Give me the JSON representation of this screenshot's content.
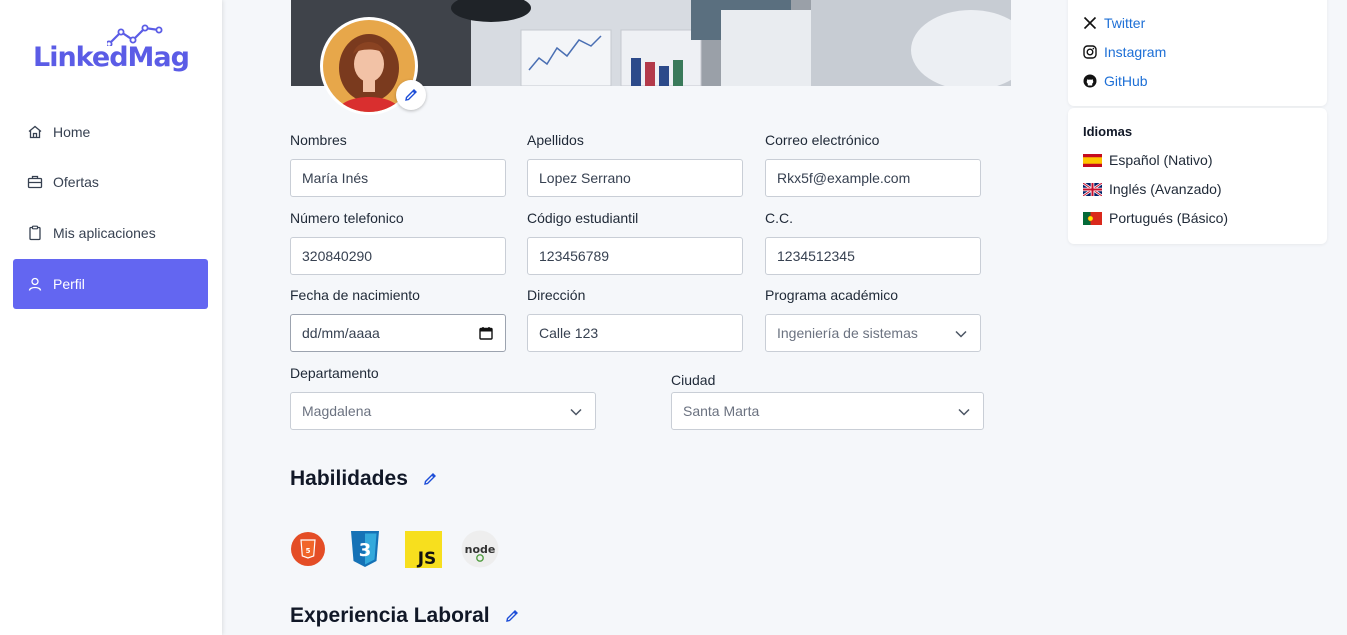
{
  "brand": {
    "name": "LinkedMag",
    "color": "#5b5ce6"
  },
  "nav": {
    "items": [
      {
        "label": "Home",
        "icon": "home-icon"
      },
      {
        "label": "Ofertas",
        "icon": "briefcase-icon"
      },
      {
        "label": "Mis aplicaciones",
        "icon": "clipboard-icon"
      },
      {
        "label": "Perfil",
        "icon": "user-icon",
        "active": true
      }
    ]
  },
  "form": {
    "nombres": {
      "label": "Nombres",
      "value": "María Inés"
    },
    "apellidos": {
      "label": "Apellidos",
      "value": "Lopez Serrano"
    },
    "correo": {
      "label": "Correo electrónico",
      "value": "Rkx5f@example.com"
    },
    "telefono": {
      "label": "Número telefonico",
      "value": "320840290"
    },
    "codigo": {
      "label": "Código estudiantil",
      "value": "123456789"
    },
    "cc": {
      "label": "C.C.",
      "value": "1234512345"
    },
    "fecha": {
      "label": "Fecha de nacimiento",
      "value": "dd/mm/aaaa"
    },
    "direccion": {
      "label": "Dirección",
      "value": "Calle 123"
    },
    "programa": {
      "label": "Programa académico",
      "value": "Ingeniería de sistemas"
    },
    "departamento": {
      "label": "Departamento",
      "value": "Magdalena"
    },
    "ciudad": {
      "label": "Ciudad",
      "value": "Santa Marta"
    }
  },
  "sections": {
    "habilidades": "Habilidades",
    "experiencia": "Experiencia Laboral"
  },
  "skills": [
    {
      "name": "html5-icon",
      "color": "#e44d26"
    },
    {
      "name": "css3-icon",
      "color": "#1572b6"
    },
    {
      "name": "javascript-icon",
      "color": "#f7df1e"
    },
    {
      "name": "nodejs-icon",
      "color": "#539e43"
    }
  ],
  "social": [
    {
      "label": "Twitter",
      "icon": "x-twitter-icon"
    },
    {
      "label": "Instagram",
      "icon": "instagram-icon"
    },
    {
      "label": "GitHub",
      "icon": "github-icon"
    }
  ],
  "languages": {
    "title": "Idiomas",
    "items": [
      {
        "label": "Español (Nativo)",
        "flag": "spain-flag-icon"
      },
      {
        "label": "Inglés (Avanzado)",
        "flag": "uk-flag-icon"
      },
      {
        "label": "Portugués (Básico)",
        "flag": "portugal-flag-icon"
      }
    ]
  },
  "colors": {
    "accent": "#6366f1",
    "link": "#1d6fd6"
  }
}
